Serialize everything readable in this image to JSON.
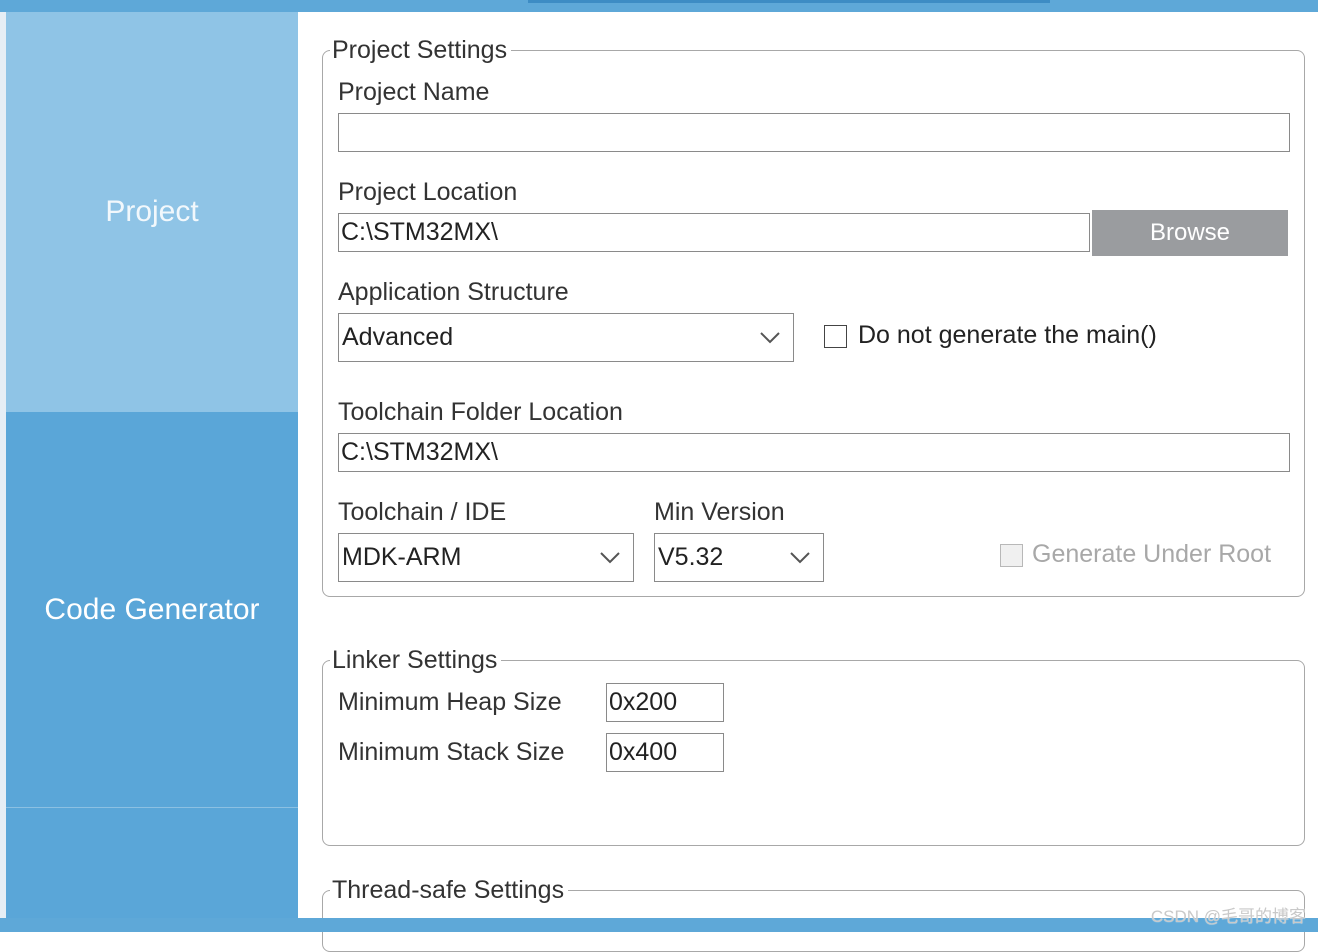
{
  "sidebar": {
    "items": [
      {
        "label": "Project"
      },
      {
        "label": "Code Generator"
      },
      {
        "label": ""
      }
    ]
  },
  "project_settings": {
    "legend": "Project Settings",
    "project_name": {
      "label": "Project Name",
      "value": ""
    },
    "project_location": {
      "label": "Project Location",
      "value": "C:\\STM32MX\\",
      "browse_label": "Browse"
    },
    "application_structure": {
      "label": "Application Structure",
      "selected": "Advanced"
    },
    "no_main": {
      "label": "Do not generate the main()",
      "checked": false
    },
    "toolchain_folder": {
      "label": "Toolchain Folder Location",
      "value": "C:\\STM32MX\\"
    },
    "toolchain_ide": {
      "label": "Toolchain / IDE",
      "selected": "MDK-ARM"
    },
    "min_version": {
      "label": "Min Version",
      "selected": "V5.32"
    },
    "generate_under_root": {
      "label": "Generate Under Root",
      "checked": false,
      "disabled": true
    }
  },
  "linker_settings": {
    "legend": "Linker Settings",
    "heap": {
      "label": "Minimum Heap Size",
      "value": "0x200"
    },
    "stack": {
      "label": "Minimum Stack Size",
      "value": "0x400"
    }
  },
  "thread_safe_settings": {
    "legend": "Thread-safe Settings"
  },
  "watermark": "CSDN @毛哥的博客",
  "colors": {
    "sidebar": "#5aa6d8",
    "sidebar_active": "#8fc4e6",
    "button": "#9a9c9f",
    "border": "#a8a8a8"
  }
}
